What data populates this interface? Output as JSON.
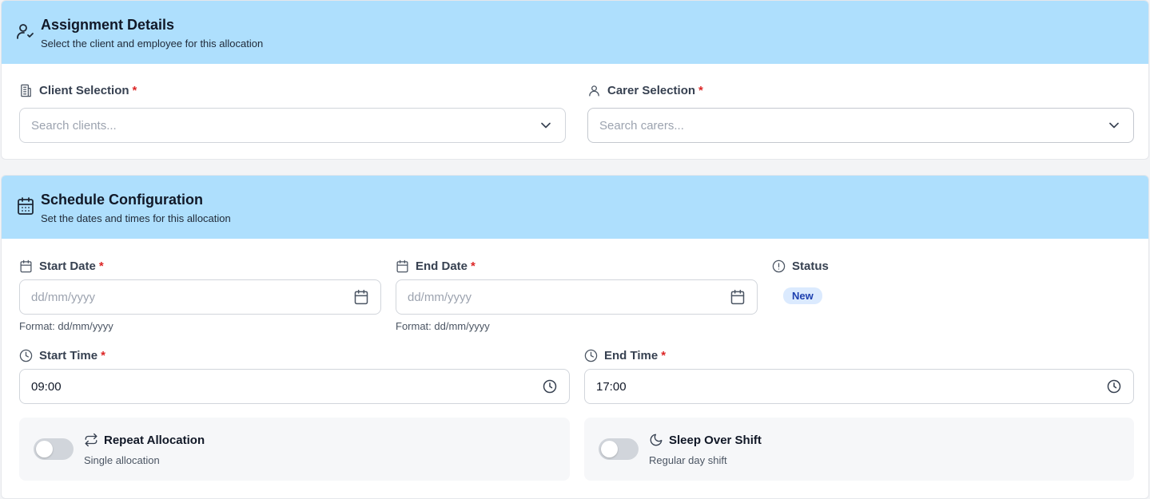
{
  "assignment": {
    "title": "Assignment Details",
    "subtitle": "Select the client and employee for this allocation",
    "client_label": "Client Selection",
    "client_placeholder": "Search clients...",
    "carer_label": "Carer Selection",
    "carer_placeholder": "Search carers...",
    "required_mark": "*"
  },
  "schedule": {
    "title": "Schedule Configuration",
    "subtitle": "Set the dates and times for this allocation",
    "start_date_label": "Start Date",
    "start_date_placeholder": "dd/mm/yyyy",
    "start_date_hint": "Format: dd/mm/yyyy",
    "end_date_label": "End Date",
    "end_date_placeholder": "dd/mm/yyyy",
    "end_date_hint": "Format: dd/mm/yyyy",
    "status_label": "Status",
    "status_value": "New",
    "start_time_label": "Start Time",
    "start_time_value": "09:00",
    "end_time_label": "End Time",
    "end_time_value": "17:00",
    "required_mark": "*"
  },
  "toggles": {
    "repeat": {
      "title": "Repeat Allocation",
      "subtitle": "Single allocation",
      "on": false,
      "icon": "repeat-icon"
    },
    "sleep": {
      "title": "Sleep Over Shift",
      "subtitle": "Regular day shift",
      "on": false,
      "icon": "moon-icon"
    }
  },
  "colors": {
    "header_bg": "#aedffd",
    "required": "#dc2626",
    "badge_bg": "#dbeafe",
    "badge_text": "#1e40af"
  }
}
